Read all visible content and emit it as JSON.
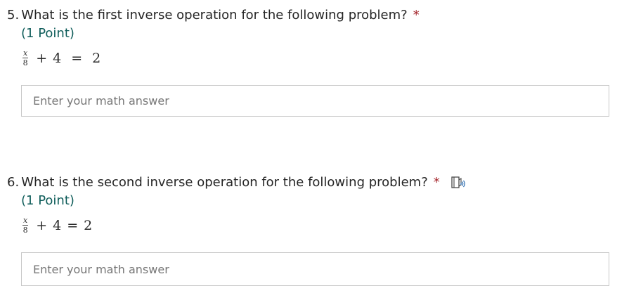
{
  "questions": [
    {
      "number": "5.",
      "text": "What is the first inverse operation for the following problem?",
      "required_mark": "*",
      "points": "(1 Point)",
      "equation": {
        "numerator": "x",
        "denominator": "8",
        "plus": "+",
        "addend": "4",
        "equals": "=",
        "result": "2"
      },
      "answer_placeholder": "Enter your math answer"
    },
    {
      "number": "6.",
      "text": "What is the second inverse operation for the following problem?",
      "required_mark": "*",
      "points": "(1 Point)",
      "equation": {
        "numerator": "x",
        "denominator": "8",
        "plus": "+",
        "addend": "4",
        "equals": "=",
        "result": "2"
      },
      "answer_placeholder": "Enter your math answer",
      "icon": "immersive-reader-icon"
    }
  ],
  "colors": {
    "required": "#a4262c",
    "points": "#0f5d5a",
    "input_border": "#c8c8c8",
    "placeholder": "#767676"
  }
}
